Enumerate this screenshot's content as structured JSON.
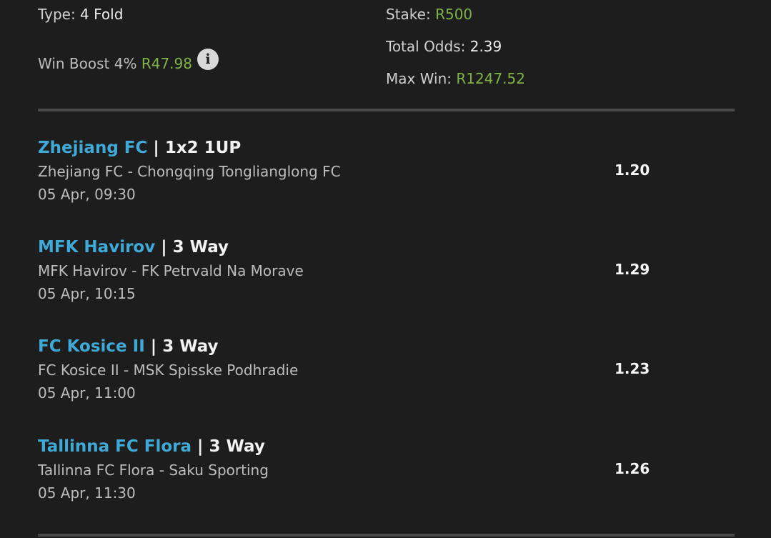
{
  "summary": {
    "type_label": "Type:",
    "type_value": "4 Fold",
    "boost_label": "Win Boost 4%",
    "boost_value": "R47.98",
    "info_icon": "info-icon",
    "stake_label": "Stake:",
    "stake_value": "R500",
    "total_odds_label": "Total Odds:",
    "total_odds_value": "2.39",
    "max_win_label": "Max Win:",
    "max_win_value": "R1247.52"
  },
  "colors": {
    "background": "#1d1d1d",
    "team_link": "#3fa9d8",
    "money_green": "#7fb347"
  },
  "legs": [
    {
      "team": "Zhejiang FC",
      "separator": "|",
      "market": "1x2 1UP",
      "match": "Zhejiang FC - Chongqing Tonglianglong FC",
      "date": "05 Apr, 09:30",
      "odds": "1.20"
    },
    {
      "team": "MFK Havirov",
      "separator": "|",
      "market": "3 Way",
      "match": "MFK Havirov - FK Petrvald Na Morave",
      "date": "05 Apr, 10:15",
      "odds": "1.29"
    },
    {
      "team": "FC Kosice II",
      "separator": "|",
      "market": "3 Way",
      "match": "FC Kosice II - MSK Spisske Podhradie",
      "date": "05 Apr, 11:00",
      "odds": "1.23"
    },
    {
      "team": "Tallinna FC Flora",
      "separator": "|",
      "market": "3 Way",
      "match": "Tallinna FC Flora - Saku Sporting",
      "date": "05 Apr, 11:30",
      "odds": "1.26"
    }
  ]
}
